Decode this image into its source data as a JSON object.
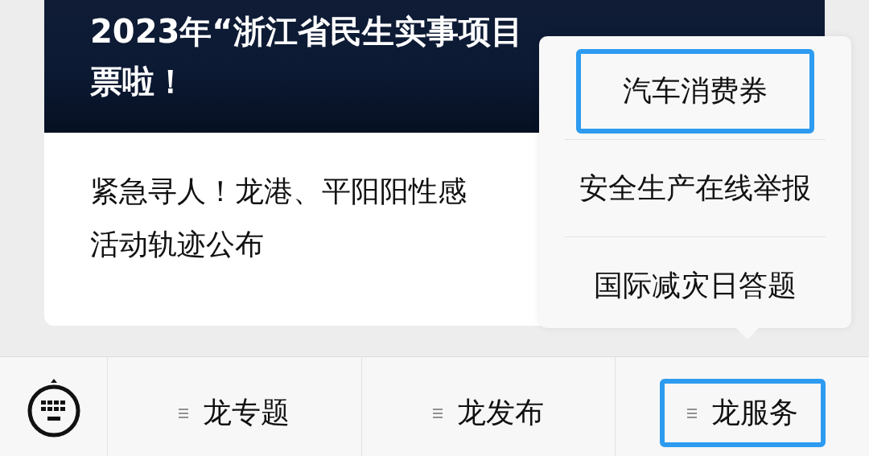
{
  "article": {
    "headline_lines": [
      "2023年“浙江省民生实事项目",
      "票啦！"
    ],
    "summary_lines": [
      "紧急寻人！龙港、平阳阳性感",
      "活动轨迹公布"
    ]
  },
  "popup_menu": {
    "items": [
      {
        "label": "汽车消费券",
        "highlighted": true
      },
      {
        "label": "安全生产在线举报",
        "highlighted": false
      },
      {
        "label": "国际减灾日答题",
        "highlighted": false
      }
    ]
  },
  "bottom_menu": {
    "items": [
      {
        "label": "龙专题",
        "highlighted": false
      },
      {
        "label": "龙发布",
        "highlighted": false
      },
      {
        "label": "龙服务",
        "highlighted": true
      }
    ]
  }
}
